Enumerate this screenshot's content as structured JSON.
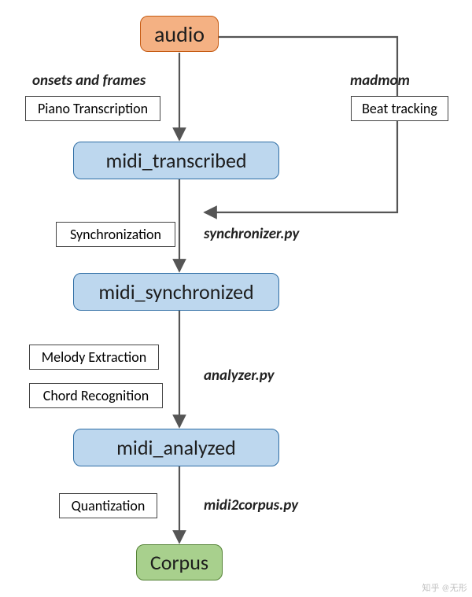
{
  "nodes": {
    "audio": "audio",
    "midi_transcribed": "midi_transcribed",
    "midi_synchronized": "midi_synchronized",
    "midi_analyzed": "midi_analyzed",
    "corpus": "Corpus"
  },
  "steps": {
    "piano_transcription": "Piano Transcription",
    "beat_tracking": "Beat tracking",
    "synchronization": "Synchronization",
    "melody_extraction": "Melody Extraction",
    "chord_recognition": "Chord Recognition",
    "quantization": "Quantization"
  },
  "labels": {
    "onsets_and_frames": "onsets and frames",
    "madmom": "madmom",
    "synchronizer_py": "synchronizer.py",
    "analyzer_py": "analyzer.py",
    "midi2corpus_py": "midi2corpus.py"
  },
  "watermark": "知乎 @无形"
}
